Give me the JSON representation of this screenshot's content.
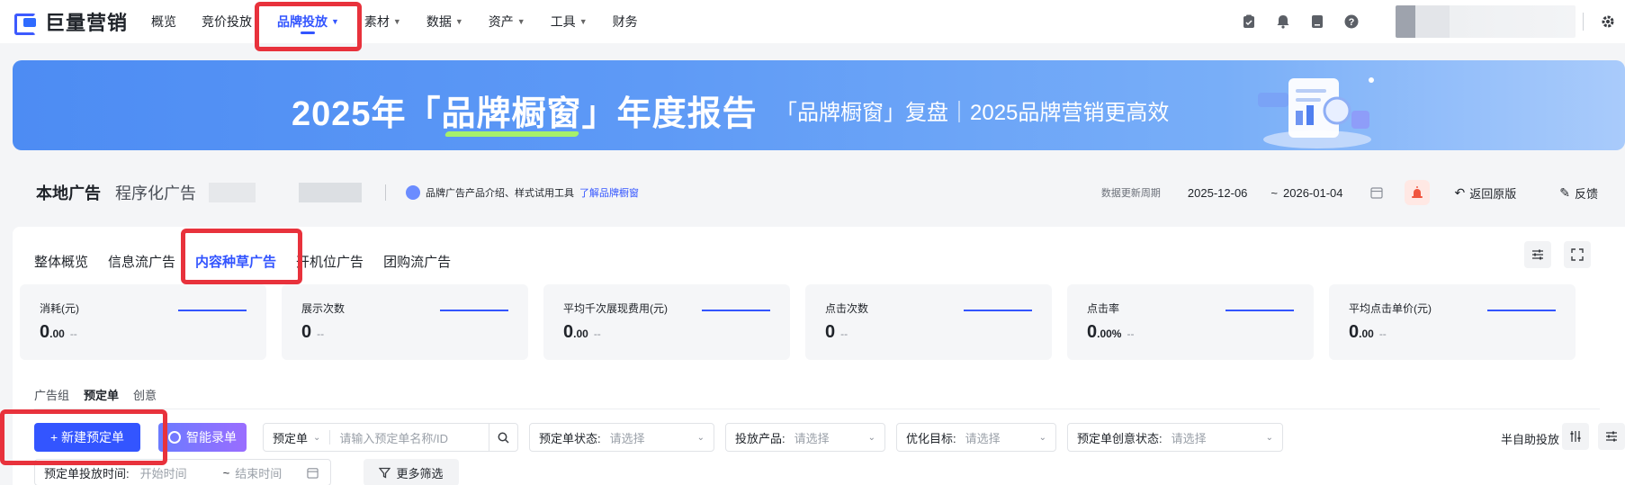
{
  "brand": {
    "logo_text": "巨量营销"
  },
  "nav": {
    "items": [
      {
        "label": "概览",
        "dropdown": false
      },
      {
        "label": "竞价投放",
        "dropdown": false
      },
      {
        "label": "品牌投放",
        "dropdown": true,
        "active": true
      },
      {
        "label": "素材",
        "dropdown": true
      },
      {
        "label": "数据",
        "dropdown": true
      },
      {
        "label": "资产",
        "dropdown": true
      },
      {
        "label": "工具",
        "dropdown": true
      },
      {
        "label": "财务",
        "dropdown": false
      }
    ],
    "right_icons": [
      "clipboard-icon",
      "bell-icon",
      "document-icon",
      "help-icon"
    ]
  },
  "banner": {
    "title_pre": "2025年「",
    "title_highlight": "品牌橱窗",
    "title_post": "」年度报告",
    "subtitle": "「品牌橱窗」复盘｜2025品牌营销更高效"
  },
  "page_header": {
    "title": "本地广告",
    "subtitle": "程序化广告",
    "info_text": "品牌广告产品介绍、样式试用工具",
    "info_link": "了解品牌橱窗",
    "data_period_label": "数据更新周期",
    "date_start": "2025-12-06",
    "date_sep": "~",
    "date_end": "2026-01-04",
    "back_label": "返回原版",
    "feedback_label": "反馈"
  },
  "tabs": [
    {
      "label": "整体概览"
    },
    {
      "label": "信息流广告"
    },
    {
      "label": "内容种草广告",
      "active": true
    },
    {
      "label": "开机位广告"
    },
    {
      "label": "团购流广告"
    }
  ],
  "metrics": [
    {
      "label": "消耗(元)",
      "value_main": "0",
      "value_small": ".00",
      "trend": "--"
    },
    {
      "label": "展示次数",
      "value_main": "0",
      "value_small": "",
      "trend": "--"
    },
    {
      "label": "平均千次展现费用(元)",
      "value_main": "0",
      "value_small": ".00",
      "trend": "--"
    },
    {
      "label": "点击次数",
      "value_main": "0",
      "value_small": "",
      "trend": "--"
    },
    {
      "label": "点击率",
      "value_main": "0",
      "value_small": ".00%",
      "trend": "--"
    },
    {
      "label": "平均点击单价(元)",
      "value_main": "0",
      "value_small": ".00",
      "trend": "--"
    }
  ],
  "sub_tabs": [
    {
      "label": "广告组"
    },
    {
      "label": "预定单",
      "active": true
    },
    {
      "label": "创意"
    }
  ],
  "filters": {
    "new_button": "+ 新建预定单",
    "ai_button": "智能录单",
    "search_type": "预定单",
    "search_placeholder": "请输入预定单名称/ID",
    "status_label": "预定单状态:",
    "status_placeholder": "请选择",
    "product_label": "投放产品:",
    "product_placeholder": "请选择",
    "goal_label": "优化目标:",
    "goal_placeholder": "请选择",
    "creative_status_label": "预定单创意状态:",
    "creative_status_placeholder": "请选择",
    "semi_auto_label": "半自助投放",
    "time_label": "预定单投放时间:",
    "time_start_placeholder": "开始时间",
    "time_sep": "~",
    "time_end_placeholder": "结束时间",
    "more_filters": "更多筛选"
  },
  "colors": {
    "accent": "#3355ff",
    "highlight_box": "#e8323c",
    "banner_start": "#4d8cf3",
    "banner_end": "#a9cbfb"
  }
}
